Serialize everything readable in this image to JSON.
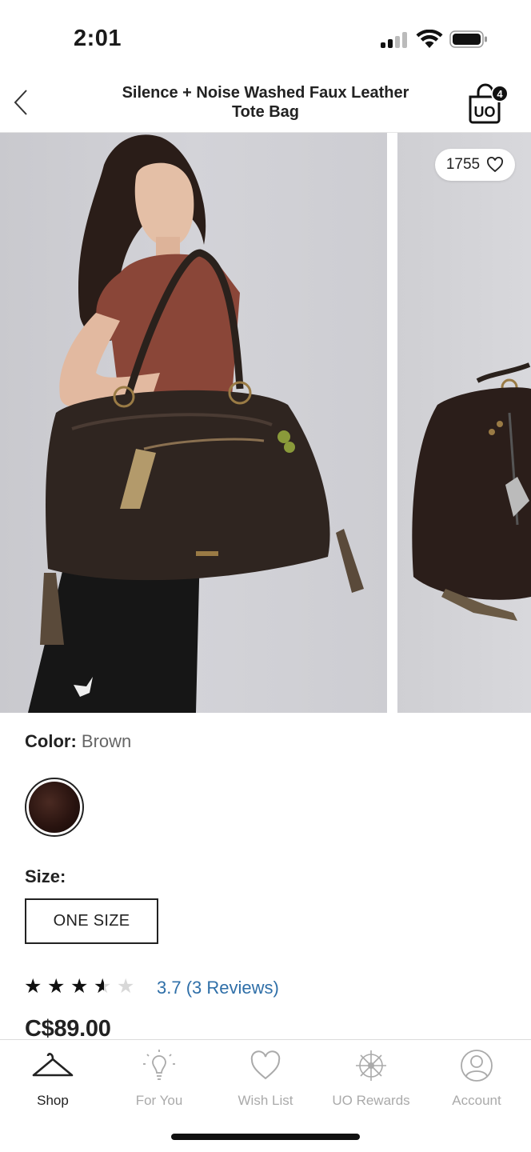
{
  "status_bar": {
    "time": "2:01"
  },
  "header": {
    "back_icon": "chevron-left-icon",
    "title": "Silence + Noise Washed Faux Leather Tote Bag",
    "bag_brand": "UO",
    "bag_count": "4"
  },
  "gallery": {
    "like_count": "1755",
    "images": [
      "model-with-brown-tote-photo",
      "brown-tote-product-photo"
    ]
  },
  "product": {
    "color_label": "Color:",
    "color_value": "Brown",
    "size_label": "Size:",
    "size_option": "ONE SIZE",
    "rating": 3.7,
    "rating_text": "3.7 (3 Reviews)",
    "price": "C$89.00"
  },
  "tab_bar": {
    "tabs": [
      {
        "label": "Shop",
        "icon": "hanger-icon",
        "active": true
      },
      {
        "label": "For You",
        "icon": "lightbulb-icon",
        "active": false
      },
      {
        "label": "Wish List",
        "icon": "heart-icon",
        "active": false
      },
      {
        "label": "UO Rewards",
        "icon": "rewards-icon",
        "active": false
      },
      {
        "label": "Account",
        "icon": "account-icon",
        "active": false
      }
    ]
  },
  "colors": {
    "link": "#2f6fa8",
    "active_tab": "#222222",
    "inactive_tab": "#aaaaaa"
  }
}
